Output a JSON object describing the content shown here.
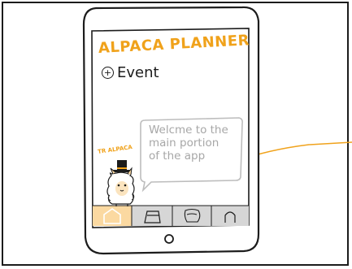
{
  "app": {
    "title": "ALPACA PLANNER"
  },
  "event": {
    "label": "Event"
  },
  "mascot": {
    "tag": "TR ALPACA"
  },
  "bubble": {
    "lines": [
      "Welcme to the",
      "main portion",
      "of the app"
    ]
  },
  "tabs": [
    {
      "icon": "home-icon",
      "active": true
    },
    {
      "icon": "calendar-icon",
      "active": false
    },
    {
      "icon": "alpaca-icon",
      "active": false
    },
    {
      "icon": "profile-icon",
      "active": false
    }
  ],
  "colors": {
    "accent": "#f0a21b",
    "ink": "#1c1c1c",
    "hint": "#a7a7a7",
    "tab_active": "#fbd9a1",
    "tab_bar": "#d6d6d6"
  }
}
